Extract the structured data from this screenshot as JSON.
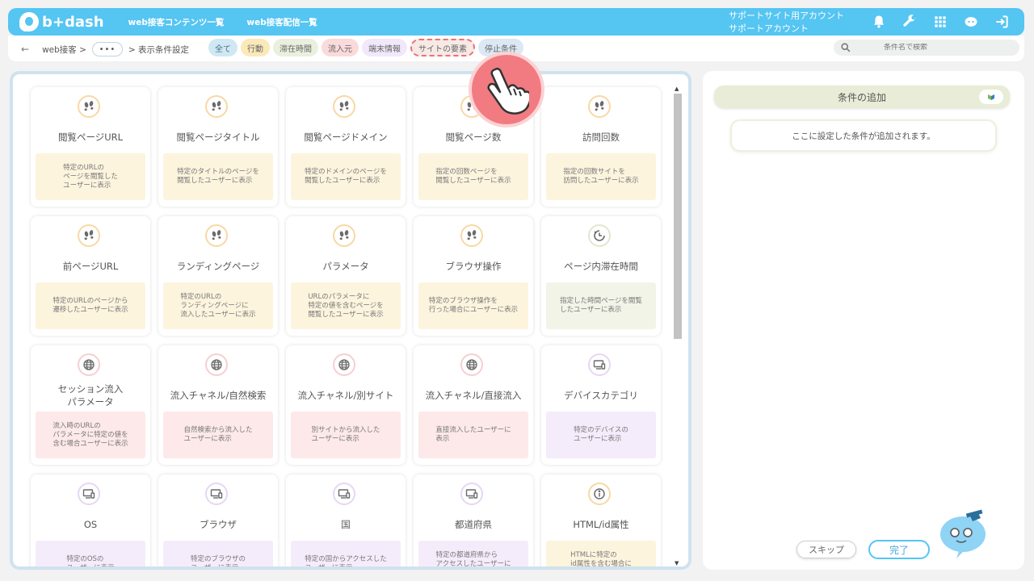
{
  "header": {
    "logo": "b+dash",
    "nav": [
      "web接客コンテンツ一覧",
      "web接客配信一覧"
    ],
    "account_line1": "サポートサイト用アカウント",
    "account_line2": "サポートアカウント",
    "icons": [
      "bell-icon",
      "wrench-icon",
      "grid-icon",
      "chat-icon",
      "logout-icon"
    ]
  },
  "subbar": {
    "back": "←",
    "crumb1": "web接客 >",
    "dots": "•••",
    "crumb2": "> 表示条件設定",
    "tabs": [
      "全て",
      "行動",
      "滞在時間",
      "流入元",
      "端末情報",
      "サイトの要素",
      "停止条件"
    ],
    "search_placeholder": "条件名で検索"
  },
  "cards": [
    {
      "title": "閲覧ページURL",
      "desc": "特定のURLの\nページを閲覧した\nユーザーに表示",
      "icon": "footprints-icon",
      "tone": "orange"
    },
    {
      "title": "閲覧ページタイトル",
      "desc": "特定のタイトルのページを\n閲覧したユーザーに表示",
      "icon": "footprints-icon",
      "tone": "orange"
    },
    {
      "title": "閲覧ページドメイン",
      "desc": "特定のドメインのページを\n閲覧したユーザーに表示",
      "icon": "footprints-icon",
      "tone": "orange"
    },
    {
      "title": "閲覧ページ数",
      "desc": "指定の回数ページを\n閲覧したユーザーに表示",
      "icon": "footprints-icon",
      "tone": "orange"
    },
    {
      "title": "訪問回数",
      "desc": "指定の回数サイトを\n訪問したユーザーに表示",
      "icon": "footprints-icon",
      "tone": "orange"
    },
    {
      "title": "前ページURL",
      "desc": "特定のURLのページから\n遷移したユーザーに表示",
      "icon": "footprints-icon",
      "tone": "orange"
    },
    {
      "title": "ランディングページ",
      "desc": "特定のURLの\nランディングページに\n流入したユーザーに表示",
      "icon": "footprints-icon",
      "tone": "orange"
    },
    {
      "title": "パラメータ",
      "desc": "URLのパラメータに\n特定の値を含むページを\n閲覧したユーザーに表示",
      "icon": "footprints-icon",
      "tone": "orange"
    },
    {
      "title": "ブラウザ操作",
      "desc": "特定のブラウザ操作を\n行った場合にユーザーに表示",
      "icon": "footprints-icon",
      "tone": "orange"
    },
    {
      "title": "ページ内滞在時間",
      "desc": "指定した時間ページを閲覧\nしたユーザーに表示",
      "icon": "clock-icon",
      "tone": "green"
    },
    {
      "title": "セッション流入\nパラメータ",
      "desc": "流入時のURLの\nパラメータに特定の値を\n含む場合ユーザーに表示",
      "icon": "globe-icon",
      "tone": "pink"
    },
    {
      "title": "流入チャネル/自然検索",
      "desc": "自然検索から流入した\nユーザーに表示",
      "icon": "globe-icon",
      "tone": "pink"
    },
    {
      "title": "流入チャネル/別サイト",
      "desc": "別サイトから流入した\nユーザーに表示",
      "icon": "globe-icon",
      "tone": "pink"
    },
    {
      "title": "流入チャネル/直接流入",
      "desc": "直接流入したユーザーに\n表示",
      "icon": "globe-icon",
      "tone": "pink"
    },
    {
      "title": "デバイスカテゴリ",
      "desc": "特定のデバイスの\nユーザーに表示",
      "icon": "device-icon",
      "tone": "purple"
    },
    {
      "title": "OS",
      "desc": "特定のOSの\nユーザーに表示",
      "icon": "device-icon",
      "tone": "purple"
    },
    {
      "title": "ブラウザ",
      "desc": "特定のブラウザの\nユーザーに表示",
      "icon": "device-icon",
      "tone": "purple"
    },
    {
      "title": "国",
      "desc": "特定の国からアクセスした\nユーザーに表示",
      "icon": "device-icon",
      "tone": "purple"
    },
    {
      "title": "都道府県",
      "desc": "特定の都道府県から\nアクセスしたユーザーに\n表示",
      "icon": "device-icon",
      "tone": "purple"
    },
    {
      "title": "HTML/id属性",
      "desc": "HTMLに特定の\nid属性を含む場合に\n表示",
      "icon": "info-icon",
      "tone": "orange"
    }
  ],
  "right": {
    "add_title": "条件の追加",
    "placeholder": "ここに設定した条件が追加されます。",
    "skip": "スキップ",
    "done": "完了"
  },
  "colors": {
    "accent": "#55c5f2",
    "highlight": "#ee6f75"
  }
}
